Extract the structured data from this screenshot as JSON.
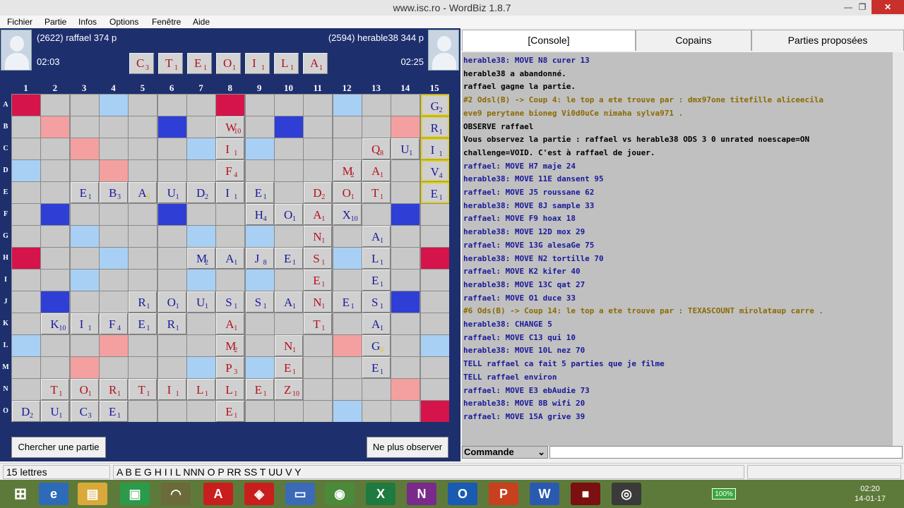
{
  "window": {
    "title": "www.isc.ro - WordBiz 1.8.7",
    "minimize": "—",
    "maximize": "❐",
    "close": "✕"
  },
  "menu": [
    "Fichier",
    "Partie",
    "Infos",
    "Options",
    "Fenêtre",
    "Aide"
  ],
  "players": {
    "left": {
      "name": "(2622) raffael  374 p",
      "clock": "02:03"
    },
    "right": {
      "name": "(2594) herable38  344 p",
      "clock": "02:25"
    }
  },
  "rack": [
    [
      "C",
      "3"
    ],
    [
      "T",
      "1"
    ],
    [
      "E",
      "1"
    ],
    [
      "O",
      "1"
    ],
    [
      "I",
      "1"
    ],
    [
      "L",
      "1"
    ],
    [
      "A",
      "1"
    ]
  ],
  "columns": [
    "1",
    "2",
    "3",
    "4",
    "5",
    "6",
    "7",
    "8",
    "9",
    "10",
    "11",
    "12",
    "13",
    "14",
    "15"
  ],
  "rows": [
    "A",
    "B",
    "C",
    "D",
    "E",
    "F",
    "G",
    "H",
    "I",
    "J",
    "K",
    "L",
    "M",
    "N",
    "O"
  ],
  "colors": {
    "TW": "#d4144a",
    "DW": "#f4a0a0",
    "TL": "#2f3fd6",
    "DL": "#a8d0f4",
    "blue_text": "#1a1a9a",
    "red_text": "#b3121d",
    "panel": "#1e2f6e"
  },
  "premiums": [
    [
      "A",
      1,
      "TW"
    ],
    [
      "A",
      8,
      "TW"
    ],
    [
      "A",
      4,
      "DL"
    ],
    [
      "A",
      12,
      "DL"
    ],
    [
      "B",
      2,
      "DW"
    ],
    [
      "B",
      6,
      "TL"
    ],
    [
      "B",
      10,
      "TL"
    ],
    [
      "B",
      14,
      "DW"
    ],
    [
      "C",
      3,
      "DW"
    ],
    [
      "C",
      7,
      "DL"
    ],
    [
      "C",
      9,
      "DL"
    ],
    [
      "C",
      13,
      "DW"
    ],
    [
      "D",
      1,
      "DL"
    ],
    [
      "D",
      4,
      "DW"
    ],
    [
      "D",
      8,
      "DL"
    ],
    [
      "D",
      12,
      "DW"
    ],
    [
      "D",
      15,
      "DL"
    ],
    [
      "E",
      5,
      "DW"
    ],
    [
      "E",
      11,
      "DW"
    ],
    [
      "F",
      2,
      "TL"
    ],
    [
      "F",
      6,
      "TL"
    ],
    [
      "F",
      10,
      "TL"
    ],
    [
      "F",
      14,
      "TL"
    ],
    [
      "G",
      3,
      "DL"
    ],
    [
      "G",
      7,
      "DL"
    ],
    [
      "G",
      9,
      "DL"
    ],
    [
      "G",
      13,
      "DL"
    ],
    [
      "H",
      1,
      "TW"
    ],
    [
      "H",
      4,
      "DL"
    ],
    [
      "H",
      12,
      "DL"
    ],
    [
      "H",
      15,
      "TW"
    ],
    [
      "I",
      3,
      "DL"
    ],
    [
      "I",
      7,
      "DL"
    ],
    [
      "I",
      9,
      "DL"
    ],
    [
      "I",
      13,
      "DL"
    ],
    [
      "J",
      2,
      "TL"
    ],
    [
      "J",
      6,
      "TL"
    ],
    [
      "J",
      10,
      "TL"
    ],
    [
      "J",
      14,
      "TL"
    ],
    [
      "K",
      5,
      "DW"
    ],
    [
      "K",
      11,
      "DW"
    ],
    [
      "L",
      1,
      "DL"
    ],
    [
      "L",
      4,
      "DW"
    ],
    [
      "L",
      8,
      "DL"
    ],
    [
      "L",
      12,
      "DW"
    ],
    [
      "L",
      15,
      "DL"
    ],
    [
      "M",
      3,
      "DW"
    ],
    [
      "M",
      7,
      "DL"
    ],
    [
      "M",
      9,
      "DL"
    ],
    [
      "M",
      13,
      "DW"
    ],
    [
      "N",
      2,
      "DW"
    ],
    [
      "N",
      6,
      "TL"
    ],
    [
      "N",
      10,
      "TL"
    ],
    [
      "N",
      14,
      "DW"
    ],
    [
      "O",
      1,
      "TW"
    ],
    [
      "O",
      4,
      "DL"
    ],
    [
      "O",
      8,
      "TW"
    ],
    [
      "O",
      12,
      "DL"
    ],
    [
      "O",
      15,
      "TW"
    ]
  ],
  "tiles": [
    [
      "A",
      15,
      "G",
      "2",
      "b",
      1
    ],
    [
      "B",
      8,
      "W",
      "10",
      "r",
      0
    ],
    [
      "B",
      15,
      "R",
      "1",
      "b",
      1
    ],
    [
      "C",
      8,
      "I",
      "1",
      "r",
      0
    ],
    [
      "C",
      13,
      "Q",
      "8",
      "r",
      0
    ],
    [
      "C",
      14,
      "U",
      "1",
      "b",
      0
    ],
    [
      "C",
      15,
      "I",
      "1",
      "b",
      1
    ],
    [
      "D",
      8,
      "F",
      "4",
      "r",
      0
    ],
    [
      "D",
      12,
      "M",
      "2",
      "r",
      0
    ],
    [
      "D",
      13,
      "A",
      "1",
      "r",
      0
    ],
    [
      "D",
      15,
      "V",
      "4",
      "b",
      1
    ],
    [
      "E",
      3,
      "E",
      "1",
      "b",
      0
    ],
    [
      "E",
      4,
      "B",
      "3",
      "b",
      0
    ],
    [
      "E",
      5,
      "A",
      "0",
      "b",
      0
    ],
    [
      "E",
      6,
      "U",
      "1",
      "b",
      0
    ],
    [
      "E",
      7,
      "D",
      "2",
      "b",
      0
    ],
    [
      "E",
      8,
      "I",
      "1",
      "b",
      0
    ],
    [
      "E",
      9,
      "E",
      "1",
      "b",
      0
    ],
    [
      "E",
      11,
      "D",
      "2",
      "r",
      0
    ],
    [
      "E",
      12,
      "O",
      "1",
      "r",
      0
    ],
    [
      "E",
      13,
      "T",
      "1",
      "r",
      0
    ],
    [
      "E",
      15,
      "E",
      "1",
      "b",
      1
    ],
    [
      "F",
      9,
      "H",
      "4",
      "b",
      0
    ],
    [
      "F",
      10,
      "O",
      "1",
      "b",
      0
    ],
    [
      "F",
      11,
      "A",
      "1",
      "r",
      0
    ],
    [
      "F",
      12,
      "X",
      "10",
      "b",
      0
    ],
    [
      "G",
      11,
      "N",
      "1",
      "r",
      0
    ],
    [
      "G",
      13,
      "A",
      "1",
      "b",
      0
    ],
    [
      "H",
      7,
      "M",
      "2",
      "b",
      0
    ],
    [
      "H",
      8,
      "A",
      "1",
      "b",
      0
    ],
    [
      "H",
      9,
      "J",
      "8",
      "b",
      0
    ],
    [
      "H",
      10,
      "E",
      "1",
      "b",
      0
    ],
    [
      "H",
      11,
      "S",
      "1",
      "r",
      0
    ],
    [
      "H",
      13,
      "L",
      "1",
      "b",
      0
    ],
    [
      "I",
      11,
      "E",
      "1",
      "r",
      0
    ],
    [
      "I",
      13,
      "E",
      "1",
      "b",
      0
    ],
    [
      "J",
      5,
      "R",
      "1",
      "b",
      0
    ],
    [
      "J",
      6,
      "O",
      "1",
      "b",
      0
    ],
    [
      "J",
      7,
      "U",
      "1",
      "b",
      0
    ],
    [
      "J",
      8,
      "S",
      "1",
      "b",
      0
    ],
    [
      "J",
      9,
      "S",
      "1",
      "b",
      0
    ],
    [
      "J",
      10,
      "A",
      "1",
      "b",
      0
    ],
    [
      "J",
      11,
      "N",
      "1",
      "r",
      0
    ],
    [
      "J",
      12,
      "E",
      "1",
      "b",
      0
    ],
    [
      "J",
      13,
      "S",
      "1",
      "b",
      0
    ],
    [
      "K",
      2,
      "K",
      "10",
      "b",
      0
    ],
    [
      "K",
      3,
      "I",
      "1",
      "b",
      0
    ],
    [
      "K",
      4,
      "F",
      "4",
      "b",
      0
    ],
    [
      "K",
      5,
      "E",
      "1",
      "b",
      0
    ],
    [
      "K",
      6,
      "R",
      "1",
      "b",
      0
    ],
    [
      "K",
      8,
      "A",
      "1",
      "r",
      0
    ],
    [
      "K",
      11,
      "T",
      "1",
      "r",
      0
    ],
    [
      "K",
      13,
      "A",
      "1",
      "b",
      0
    ],
    [
      "L",
      8,
      "M",
      "2",
      "r",
      0
    ],
    [
      "L",
      10,
      "N",
      "1",
      "r",
      0
    ],
    [
      "L",
      13,
      "G",
      "0",
      "b",
      0
    ],
    [
      "M",
      8,
      "P",
      "3",
      "r",
      0
    ],
    [
      "M",
      10,
      "E",
      "1",
      "r",
      0
    ],
    [
      "M",
      13,
      "E",
      "1",
      "b",
      0
    ],
    [
      "N",
      2,
      "T",
      "1",
      "r",
      0
    ],
    [
      "N",
      3,
      "O",
      "1",
      "r",
      0
    ],
    [
      "N",
      4,
      "R",
      "1",
      "r",
      0
    ],
    [
      "N",
      5,
      "T",
      "1",
      "r",
      0
    ],
    [
      "N",
      6,
      "I",
      "1",
      "r",
      0
    ],
    [
      "N",
      7,
      "L",
      "1",
      "r",
      0
    ],
    [
      "N",
      8,
      "L",
      "1",
      "r",
      0
    ],
    [
      "N",
      9,
      "E",
      "1",
      "r",
      0
    ],
    [
      "N",
      10,
      "Z",
      "10",
      "r",
      0
    ],
    [
      "O",
      1,
      "D",
      "2",
      "b",
      0
    ],
    [
      "O",
      2,
      "U",
      "1",
      "b",
      0
    ],
    [
      "O",
      3,
      "C",
      "3",
      "b",
      0
    ],
    [
      "O",
      4,
      "E",
      "1",
      "b",
      0
    ],
    [
      "O",
      8,
      "E",
      "1",
      "r",
      0
    ]
  ],
  "buttons": {
    "search": "Chercher une partie",
    "stop": "Ne plus observer"
  },
  "tabs": [
    "[Console]",
    "Copains",
    "Parties proposées"
  ],
  "console_lines": [
    {
      "t": "herable38: MOVE N8 curer 13",
      "c": "#1a1a9a"
    },
    {
      "t": "herable38 a abandonné.",
      "c": "#000000"
    },
    {
      "t": "raffael gagne la partie.",
      "c": "#000000"
    },
    {
      "t": "#2 Odsl(B) -> Coup 4: le top a ete trouve par : dmx97one titefille aliceecila",
      "c": "#8a6a00"
    },
    {
      "t": "eve9 perytane bioneg Vi0d0uCe nimaha sylva971 .",
      "c": "#8a6a00"
    },
    {
      "t": "OBSERVE raffael",
      "c": "#000000"
    },
    {
      "t": "Vous observez la partie : raffael vs herable38 ODS 3 0 unrated noescape=ON",
      "c": "#000000"
    },
    {
      "t": "challenge=VOID. C'est à raffael de jouer.",
      "c": "#000000"
    },
    {
      "t": "raffael: MOVE H7 maje 24",
      "c": "#1a1a9a"
    },
    {
      "t": "herable38: MOVE 11E dansent 95",
      "c": "#1a1a9a"
    },
    {
      "t": "raffael: MOVE J5 roussane 62",
      "c": "#1a1a9a"
    },
    {
      "t": "herable38: MOVE 8J sample 33",
      "c": "#1a1a9a"
    },
    {
      "t": "raffael: MOVE F9 hoax 18",
      "c": "#1a1a9a"
    },
    {
      "t": "herable38: MOVE 12D mox 29",
      "c": "#1a1a9a"
    },
    {
      "t": "raffael: MOVE 13G alesaGe 75",
      "c": "#1a1a9a"
    },
    {
      "t": "herable38: MOVE N2 tortille 70",
      "c": "#1a1a9a"
    },
    {
      "t": "raffael: MOVE K2 kifer 40",
      "c": "#1a1a9a"
    },
    {
      "t": "herable38: MOVE 13C qat 27",
      "c": "#1a1a9a"
    },
    {
      "t": "raffael: MOVE O1 duce 33",
      "c": "#1a1a9a"
    },
    {
      "t": "#6 Ods(B) -> Coup 14: le top a ete trouve par : TEXASCOUNT mirolataup carre .",
      "c": "#8a6a00"
    },
    {
      "t": "herable38: CHANGE 5",
      "c": "#1a1a9a"
    },
    {
      "t": "raffael: MOVE C13 qui 10",
      "c": "#1a1a9a"
    },
    {
      "t": "herable38: MOVE 10L nez 70",
      "c": "#1a1a9a"
    },
    {
      "t": "TELL raffael ca fait 5 parties que je filme",
      "c": "#1a1a9a"
    },
    {
      "t": "TELL raffael environ",
      "c": "#1a1a9a"
    },
    {
      "t": "raffael: MOVE E3 ebAudie 73",
      "c": "#1a1a9a"
    },
    {
      "t": "herable38: MOVE 8B wifi 20",
      "c": "#1a1a9a"
    },
    {
      "t": "raffael: MOVE 15A grive 39",
      "c": "#1a1a9a"
    }
  ],
  "command": {
    "label": "Commande",
    "arrow": "⌄"
  },
  "status": {
    "count": "15 lettres",
    "letters": "A B E G H I I L NNN O P RR SS T UU V Y"
  },
  "taskbar": {
    "time": "02:20",
    "date": "14-01-17",
    "battery": "100%"
  }
}
